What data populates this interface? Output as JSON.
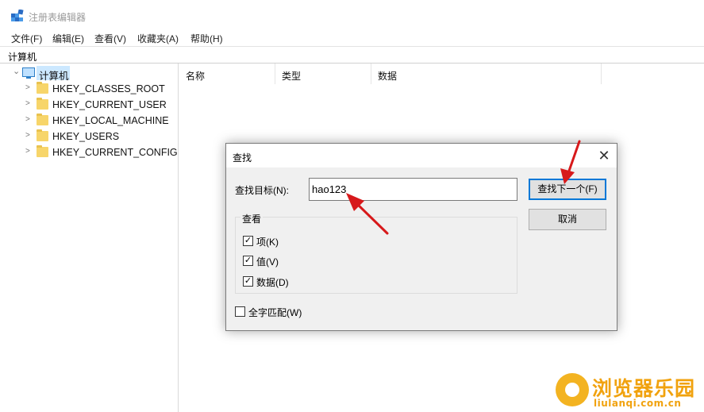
{
  "window": {
    "title": "注册表编辑器"
  },
  "menu": [
    "文件(F)",
    "编辑(E)",
    "查看(V)",
    "收藏夹(A)",
    "帮助(H)"
  ],
  "address": "计算机",
  "tree": {
    "root": "计算机",
    "items": [
      "HKEY_CLASSES_ROOT",
      "HKEY_CURRENT_USER",
      "HKEY_LOCAL_MACHINE",
      "HKEY_USERS",
      "HKEY_CURRENT_CONFIG"
    ]
  },
  "list": {
    "columns": [
      "名称",
      "类型",
      "数据"
    ]
  },
  "dialog": {
    "title": "查找",
    "find_label": "查找目标(N):",
    "find_value": "hao123",
    "find_next": "查找下一个(F)",
    "cancel": "取消",
    "look_at": "查看",
    "options": [
      {
        "label": "项(K)",
        "checked": true
      },
      {
        "label": "值(V)",
        "checked": true
      },
      {
        "label": "数据(D)",
        "checked": true
      }
    ],
    "match_whole": {
      "label": "全字匹配(W)",
      "checked": false
    }
  },
  "watermark": {
    "title": "浏览器乐园",
    "subtitle": "liulanqi.com.cn"
  },
  "colors": {
    "accent": "#0078d7",
    "arrow": "#d7191b",
    "watermark": "#f1a20e"
  }
}
